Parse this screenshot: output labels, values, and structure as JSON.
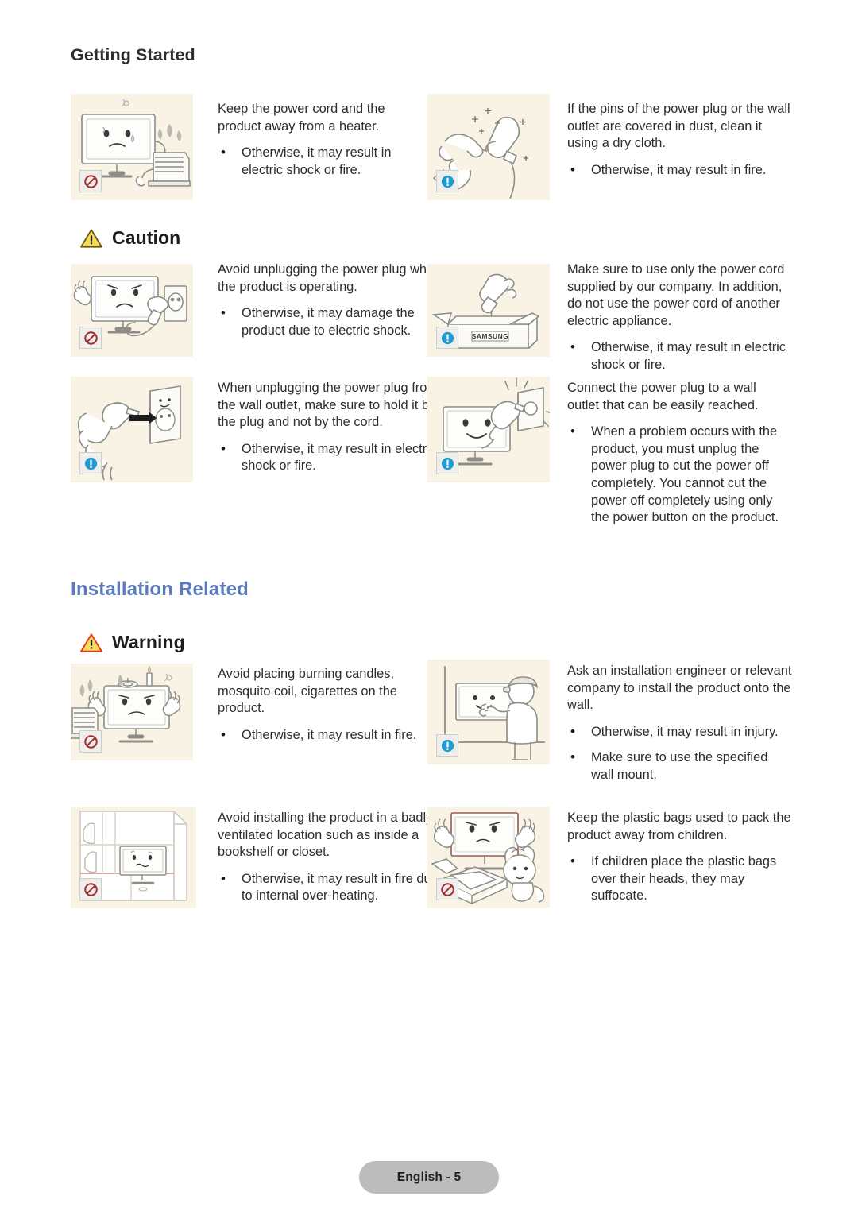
{
  "document": {
    "running_head": "Getting Started",
    "footer_label": "English - 5"
  },
  "colors": {
    "section_title": "#5b7bbd",
    "thumb_background": "#f8f3e4",
    "prohibition_red": "#a32b2b",
    "info_blue": "#1f9bd1",
    "caution_triangle_fill": "#f5dd5a",
    "caution_triangle_stroke": "#6b5a16",
    "warning_triangle_fill": "#f5dd5a",
    "warning_triangle_stroke": "#e8341c",
    "footer_pill": "#bcbcbc"
  },
  "icons": {
    "prohibition": "prohibition-icon",
    "info": "info-exclamation-icon",
    "caution_triangle": "caution-triangle-icon",
    "warning_triangle": "warning-triangle-icon"
  },
  "sections": [
    {
      "id": "power-related-continued",
      "title": null,
      "alert": null,
      "items": [
        {
          "id": "cord-away-from-heater",
          "badge": "prohibition",
          "illustration": "monitor-sweating-next-to-heater",
          "lead": "Keep the power cord and the product away from a heater.",
          "bullets": [
            "Otherwise, it may result in electric shock or fire."
          ]
        },
        {
          "id": "clean-dusty-plug-pins",
          "badge": "info",
          "illustration": "hand-wiping-plug-with-cloth",
          "lead": "If the pins of the power plug or the wall outlet are covered in dust, clean it using a dry cloth.",
          "bullets": [
            "Otherwise, it may result in fire."
          ]
        }
      ]
    },
    {
      "id": "power-caution",
      "title": null,
      "alert": {
        "label": "Caution",
        "icon": "caution_triangle"
      },
      "items": [
        {
          "id": "avoid-unplugging-while-operating",
          "badge": "prohibition",
          "illustration": "angry-monitor-plug-pulled-from-outlet",
          "lead": "Avoid unplugging the power plug while the product is operating.",
          "bullets": [
            "Otherwise, it may damage the product due to electric shock."
          ]
        },
        {
          "id": "use-supplied-power-cord-only",
          "badge": "info",
          "illustration": "plug-coming-out-of-samsung-box",
          "lead": "Make sure to use only the power cord supplied by our company. In addition, do not use the power cord of another electric appliance.",
          "bullets": [
            "Otherwise, it may result in electric shock or fire."
          ]
        },
        {
          "id": "hold-plug-not-cord",
          "badge": "info",
          "illustration": "hand-pulling-plug-from-wall-outlet",
          "lead": "When unplugging the power plug from the wall outlet, make sure to hold it by the plug and not by the cord.",
          "bullets": [
            "Otherwise, it may result in electric shock or fire."
          ]
        },
        {
          "id": "use-easily-reached-outlet",
          "badge": "info",
          "illustration": "smiling-monitor-plugging-into-outlet",
          "lead": "Connect the power plug to a wall outlet that can be easily reached.",
          "bullets": [
            "When a problem occurs with the product, you must unplug the power plug to cut the power off completely. You cannot cut the power off completely using only the power button on the product."
          ]
        }
      ]
    },
    {
      "id": "installation-related",
      "title": "Installation Related",
      "alert": {
        "label": "Warning",
        "icon": "warning_triangle"
      },
      "items": [
        {
          "id": "no-burning-candles-on-product",
          "badge": "prohibition",
          "illustration": "monitor-with-candle-and-mosquito-coil",
          "lead": "Avoid placing burning candles, mosquito coil, cigarettes on the product.",
          "bullets": [
            "Otherwise, it may result in fire."
          ]
        },
        {
          "id": "ask-engineer-for-wall-install",
          "badge": "info",
          "illustration": "engineer-installing-monitor-on-wall",
          "lead": "Ask an installation engineer or relevant company to install the product onto the wall.",
          "bullets": [
            "Otherwise, it may result in injury.",
            "Make sure to use the specified wall mount."
          ]
        },
        {
          "id": "avoid-badly-ventilated-location",
          "badge": "prohibition",
          "illustration": "monitor-inside-bookshelf-closet",
          "lead": "Avoid installing the product in a badly-ventilated location such as inside a bookshelf or closet.",
          "bullets": [
            "Otherwise, it may result in fire due to internal over-heating."
          ]
        },
        {
          "id": "keep-plastic-bags-from-children",
          "badge": "prohibition",
          "illustration": "child-with-plastic-bag-near-unboxed-monitor",
          "lead": "Keep the plastic bags used to pack the product away from children.",
          "bullets": [
            "If children place the plastic bags over their heads, they may suffocate."
          ]
        }
      ]
    }
  ]
}
